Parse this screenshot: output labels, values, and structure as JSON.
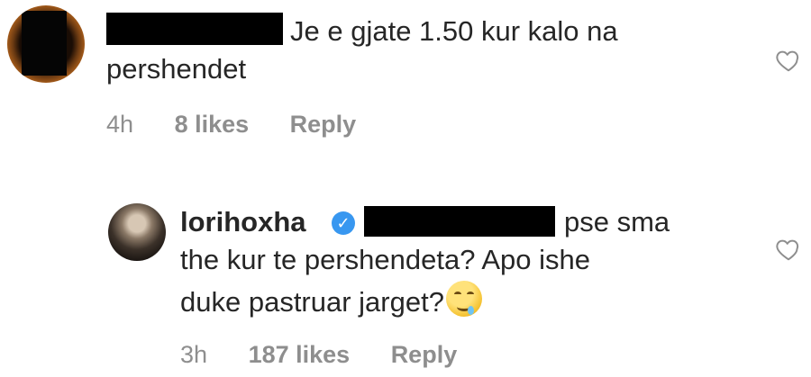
{
  "comments": [
    {
      "text_line1": "Je e gjate 1.50 kur kalo na",
      "text_line2": "pershendet",
      "time": "4h",
      "likes": "8 likes",
      "reply": "Reply"
    },
    {
      "username": "lorihoxha",
      "text_line1": "pse sma",
      "text_line2": "the kur te pershendeta? Apo ishe",
      "text_line3": "duke pastruar jarget?",
      "time": "3h",
      "likes": "187 likes",
      "reply": "Reply"
    }
  ],
  "icons": {
    "like": "heart-outline-icon",
    "verified": "verified-badge-icon",
    "emoji": "drooling-face-emoji"
  },
  "colors": {
    "text": "#262626",
    "meta": "#8e8e8e",
    "verified": "#3897f0",
    "redaction": "#000000"
  }
}
